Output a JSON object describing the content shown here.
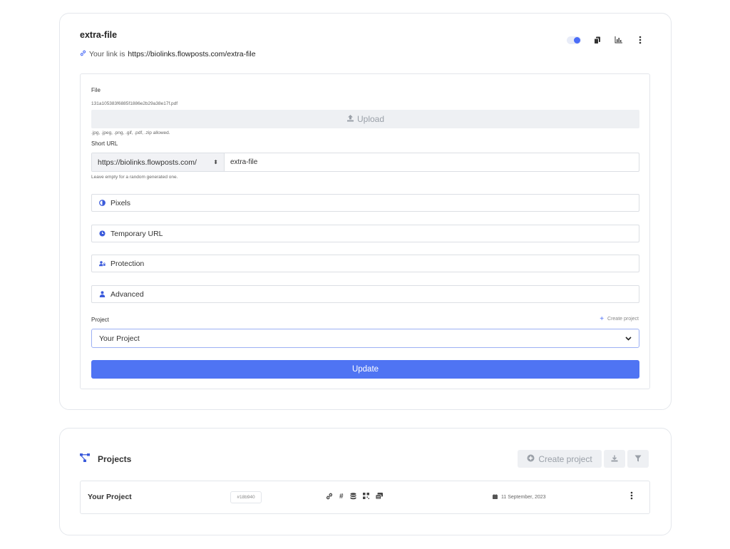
{
  "link": {
    "title": "extra-file",
    "url_prefix": "Your link is",
    "url": "https://biolinks.flowposts.com/extra-file",
    "toggle_on": true
  },
  "form": {
    "file_label": "File",
    "file_name": "131a105383f6885f1886e2b29a38e17f.pdf",
    "upload_label": "Upload",
    "allowed_types": ".jpg, .jpeg, .png, .gif, .pdf, .zip allowed.",
    "short_url_label": "Short URL",
    "domain_value": "https://biolinks.flowposts.com/",
    "slug_value": "extra-file",
    "short_url_help": "Leave empty for a random generated one.",
    "sections": [
      "Pixels",
      "Temporary URL",
      "Protection",
      "Advanced"
    ],
    "project_label": "Project",
    "create_project_label": "Create project",
    "project_selected": "Your Project",
    "update_label": "Update"
  },
  "projects": {
    "heading": "Projects",
    "create_label": "Create project",
    "rows": [
      {
        "name": "Your Project",
        "color": "#18b940",
        "date": "11 September, 2023"
      }
    ]
  },
  "colors": {
    "accent": "#4f74f3",
    "icon_blue": "#3b5bdb"
  }
}
